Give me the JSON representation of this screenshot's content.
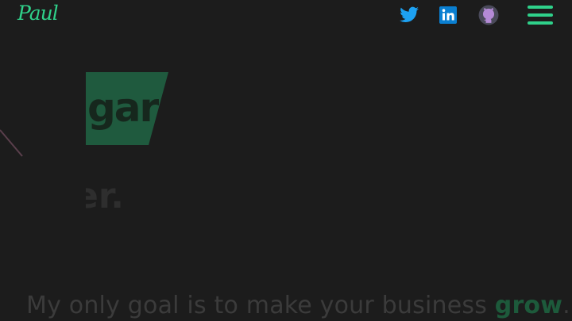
{
  "header": {
    "logo_text": "Paul",
    "social": [
      {
        "name": "twitter",
        "icon": "twitter-icon",
        "color": "#1da1f2"
      },
      {
        "name": "linkedin",
        "icon": "linkedin-icon",
        "color": "#0a7fd1"
      },
      {
        "name": "github",
        "icon": "github-icon",
        "color": "#b48ad6"
      }
    ],
    "menu_icon": "hamburger-menu-icon",
    "accent_color": "#2fd18a"
  },
  "hero": {
    "highlight_fragment": "gar",
    "line2_fragment": "er.",
    "highlight_color": "#1f5a3e"
  },
  "tagline": {
    "text": "My only goal is to make your business ",
    "accent_word": "grow",
    "end": "."
  }
}
